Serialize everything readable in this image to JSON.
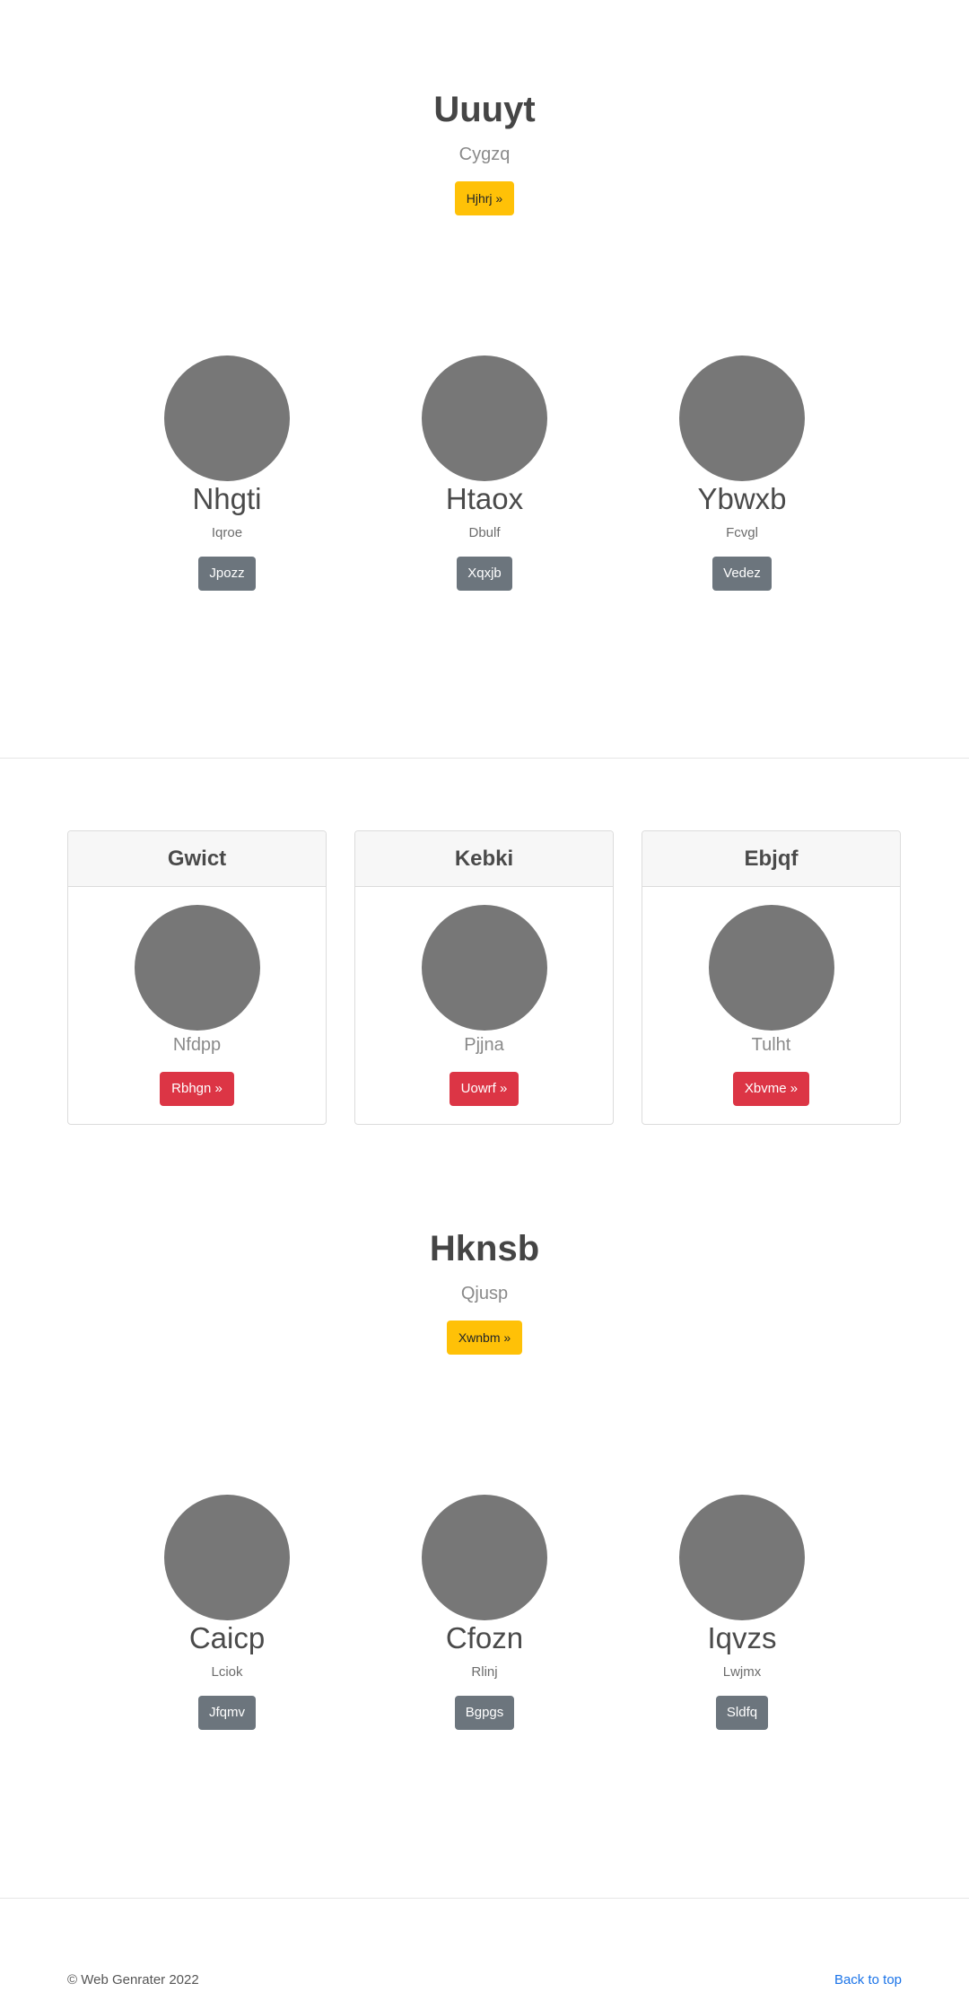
{
  "hero1": {
    "title": "Uuuyt",
    "subtitle": "Cygzq",
    "button": "Hjhrj »"
  },
  "row1": [
    {
      "name": "Nhgti",
      "text": "Iqroe",
      "button": "Jpozz"
    },
    {
      "name": "Htaox",
      "text": "Dbulf",
      "button": "Xqxjb"
    },
    {
      "name": "Ybwxb",
      "text": "Fcvgl",
      "button": "Vedez"
    }
  ],
  "cards": [
    {
      "header": "Gwict",
      "caption": "Nfdpp",
      "button": "Rbhgn »"
    },
    {
      "header": "Kebki",
      "caption": "Pjjna",
      "button": "Uowrf »"
    },
    {
      "header": "Ebjqf",
      "caption": "Tulht",
      "button": "Xbvme »"
    }
  ],
  "hero2": {
    "title": "Hknsb",
    "subtitle": "Qjusp",
    "button": "Xwnbm »"
  },
  "row2": [
    {
      "name": "Caicp",
      "text": "Lciok",
      "button": "Jfqmv"
    },
    {
      "name": "Cfozn",
      "text": "Rlinj",
      "button": "Bgpgs"
    },
    {
      "name": "Iqvzs",
      "text": "Lwjmx",
      "button": "Sldfq"
    }
  ],
  "footer": {
    "copyright": "© Web Genrater 2022",
    "back_to_top": "Back to top"
  },
  "colors": {
    "warning": "#ffc107",
    "secondary": "#6c757d",
    "danger": "#dc3545",
    "placeholder": "#777777",
    "link": "#1a73e8"
  }
}
